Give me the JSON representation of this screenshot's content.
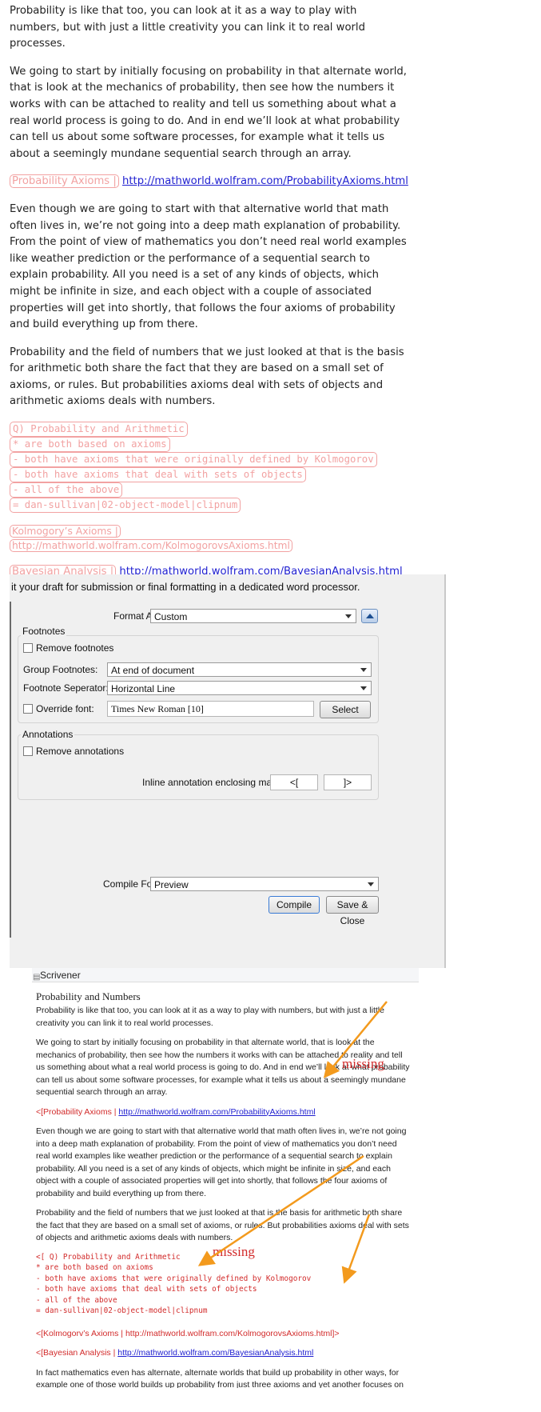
{
  "editor": {
    "para1": "Probability is like that too, you can look at it as a way to play with numbers, but with just a little creativity you can link it to real world processes.",
    "para2": "We going to start by initially focusing on probability in that alternate world, that is look at the mechanics of probability, then see how the numbers it works with can be attached to reality and tell us something about what a real world process is going to do. And in end we’ll look at what probability can tell us about some software processes, for example what it tells us about a seemingly mundane sequential search through an array.",
    "link1_label": "Probability Axioms |",
    "link1_url": "http://mathworld.wolfram.com/ProbabilityAxioms.html",
    "para3": "Even though we are going to start with that alternative world that math often lives in, we’re not going into a deep math explanation of probability. From the point of view of mathematics you don’t need real world examples like weather prediction or the performance of a sequential search to explain probability. All you need is a set of any kinds of objects, which might be infinite in size, and each object with a couple of associated properties will get into shortly, that follows the four axioms of probability and build everything up from there.",
    "para4": "Probability and the field of numbers that we just looked at that is the basis for arithmetic both share the fact that they are based on a small set of axioms, or rules. But probabilities axioms deal with sets of objects and arithmetic axioms deals with numbers.",
    "quiz": [
      "Q) Probability and Arithmetic",
      "* are both based on axioms",
      "- both have axioms that were originally defined by Kolmogorov",
      "- both have axioms that deal with sets of objects",
      "- all of the above",
      "= dan-sullivan|02-object-model|clipnum"
    ],
    "link2_label": "Kolmogory’s Axioms |",
    "link2_url": "http://mathworld.wolfram.com/KolmogorovsAxioms.html",
    "link3_label": "Bayesian Analysis |",
    "link3_url": "http://mathworld.wolfram.com/BayesianAnalysis.html"
  },
  "dialog": {
    "intro": "it your draft for submission or final formatting in a dedicated word processor.",
    "format_as_label": "Format As:",
    "format_as_value": "Custom",
    "footnotes_heading": "Footnotes",
    "remove_footnotes": "Remove footnotes",
    "group_footnotes_label": "Group Footnotes:",
    "group_footnotes_value": "At end of document",
    "footnote_separator_label": "Footnote Seperator:",
    "footnote_separator_value": "Horizontal Line",
    "override_font": "Override font:",
    "font_value": "Times New Roman [10]",
    "select_button": "Select",
    "annotations_heading": "Annotations",
    "remove_annotations": "Remove annotations",
    "inline_markers_label": "Inline annotation enclosing markers:",
    "marker_open": "<[",
    "marker_close": "]>",
    "compile_for_label": "Compile For:",
    "compile_for_value": "Preview",
    "compile_button": "Compile",
    "save_close_button": "Save & Close"
  },
  "output": {
    "window_title": "Scrivener",
    "heading": "Probability and Numbers",
    "para1": "Probability is like that too, you can look at it as a way to play with numbers, but with just a little creativity you can link it to real world processes.",
    "para2": "We going to start by initially focusing on probability in that alternate world, that is look at the mechanics of probability, then see how the numbers it works with can be attached to reality and tell us something about what a real world process is going to do. And in end we’ll look at what probability can tell us about some software processes, for example what it tells us about a seemingly mundane sequential search through an array.",
    "link1_prefix": "<[Probability Axioms |",
    "link1_url": "http://mathworld.wolfram.com/ProbabilityAxioms.html",
    "para3": "Even though we are going to start with that alternative world that math often lives in, we’re not going into a deep math explanation of probability. From the point of view of mathematics you don’t need real world examples like weather prediction or the performance of a sequential search to explain probability. All you need is a set of any kinds of objects, which might be infinite in size, and each object with a couple of associated properties will get into shortly, that follows the four axioms of probability and build everything up from there.",
    "para4": "Probability and the field of numbers that we just looked at that is the basis for arithmetic both share the fact that they are based on a small set of axioms, or rules. But probabilities axioms deal with sets of objects and arithmetic axioms deals with numbers.",
    "quiz": [
      "<[ Q) Probability and Arithmetic",
      "* are both based on axioms",
      "- both have axioms that were originally defined by Kolmogorov",
      "- both have axioms that deal with sets of objects",
      "- all of the above",
      "= dan-sullivan|02-object-model|clipnum"
    ],
    "kolmogorov_line": "<[Kolmogorv’s Axioms | http://mathworld.wolfram.com/KolmogorovsAxioms.html]>",
    "link3_prefix": "<[Bayesian Analysis |",
    "link3_url": "http://mathworld.wolfram.com/BayesianAnalysis.html",
    "para5": "In fact mathematics even has alternate, alternate worlds that build up probability in other ways, for example one of those world builds up probability from just three axioms and yet another focuses on"
  },
  "callouts": {
    "missing_1": "missing",
    "missing_2": "missing",
    "arrow_color": "#f39a1d",
    "label_color": "#d22b2b"
  }
}
